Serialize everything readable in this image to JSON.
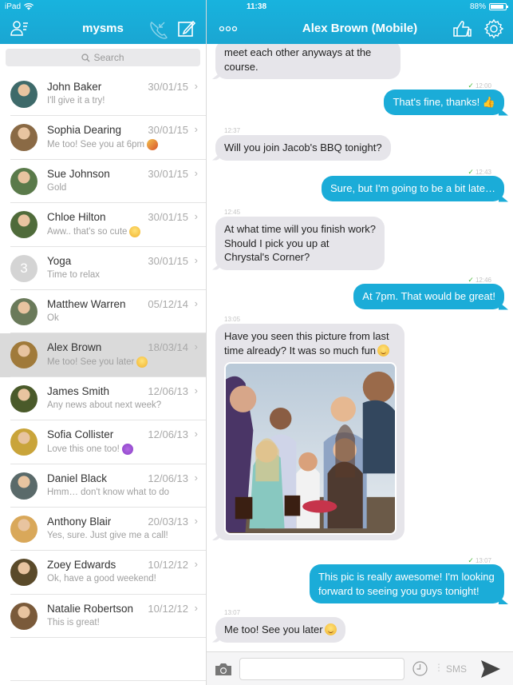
{
  "status_bar": {
    "device": "iPad",
    "time": "11:38",
    "battery": "88%",
    "battery_level": 0.88
  },
  "sidebar_header": {
    "title": "mysms",
    "icons": [
      "contacts-icon",
      "call-forward-icon",
      "compose-icon"
    ]
  },
  "chat_header": {
    "title": "Alex Brown (Mobile)",
    "icons": [
      "more-icon",
      "thumbs-up-icon",
      "gear-icon"
    ]
  },
  "search": {
    "placeholder": "Search"
  },
  "conversations": [
    {
      "name": "John Baker",
      "date": "30/01/15",
      "preview": "I'll give it a try!",
      "emoji": "",
      "avatar_color": "#3e6a6a"
    },
    {
      "name": "Sophia Dearing",
      "date": "30/01/15",
      "preview": "Me too! See you at 6pm",
      "emoji": "pizza",
      "avatar_color": "#8a6a45"
    },
    {
      "name": "Sue Johnson",
      "date": "30/01/15",
      "preview": "Gold",
      "emoji": "",
      "avatar_color": "#5a7a4a"
    },
    {
      "name": "Chloe Hilton",
      "date": "30/01/15",
      "preview": "Aww.. that's so cute",
      "emoji": "smile",
      "avatar_color": "#4f6b3a"
    },
    {
      "name": "Yoga",
      "date": "30/01/15",
      "preview": "Time to relax",
      "emoji": "",
      "placeholder": "3"
    },
    {
      "name": "Matthew Warren",
      "date": "05/12/14",
      "preview": "Ok",
      "emoji": "",
      "avatar_color": "#6a7a5a"
    },
    {
      "name": "Alex Brown",
      "date": "18/03/14",
      "preview": "Me too! See you later",
      "emoji": "smile",
      "avatar_color": "#a07a3a",
      "selected": true
    },
    {
      "name": "James Smith",
      "date": "12/06/13",
      "preview": "Any news about next week?",
      "emoji": "",
      "avatar_color": "#4a5a2a"
    },
    {
      "name": "Sofia Collister",
      "date": "12/06/13",
      "preview": "Love this one too!",
      "emoji": "purple-heart",
      "avatar_color": "#c9a43a"
    },
    {
      "name": "Daniel Black",
      "date": "12/06/13",
      "preview": "Hmm… don't know what to do",
      "emoji": "",
      "avatar_color": "#5a6a6a"
    },
    {
      "name": "Anthony Blair",
      "date": "20/03/13",
      "preview": "Yes, sure. Just give me a call!",
      "emoji": "",
      "avatar_color": "#d9a85a"
    },
    {
      "name": "Zoey Edwards",
      "date": "10/12/12",
      "preview": "Ok, have a good weekend!",
      "emoji": "",
      "avatar_color": "#5a4a2a"
    },
    {
      "name": "Natalie Robertson",
      "date": "10/12/12",
      "preview": "This is great!",
      "emoji": "",
      "avatar_color": "#7a5a3a"
    }
  ],
  "messages": [
    {
      "dir": "in",
      "text": "meet each other anyways at the course.",
      "time": ""
    },
    {
      "dir": "out",
      "text": "That's fine, thanks! 👍",
      "time": "12:00",
      "delivered": true
    },
    {
      "dir": "in",
      "text": "Will you join Jacob's BBQ tonight?",
      "time": "12:37"
    },
    {
      "dir": "out",
      "text": "Sure, but I'm going to be a bit late…",
      "time": "12:43",
      "delivered": true
    },
    {
      "dir": "in",
      "text": "At what time will you finish work? Should I pick you up at Chrystal's Corner?",
      "time": "12:45"
    },
    {
      "dir": "out",
      "text": "At 7pm. That would be great!",
      "time": "12:46",
      "delivered": true
    },
    {
      "dir": "in",
      "text": "Have you seen this picture from last time already? It was so much fun",
      "time": "13:05",
      "has_photo": true,
      "photo_alt": "Group of friends toasting drinks outdoors"
    },
    {
      "dir": "out",
      "text": "This pic is really awesome! I'm looking forward to seeing you guys tonight!",
      "time": "13:07",
      "delivered": true
    },
    {
      "dir": "in",
      "text": "Me too! See you later",
      "time": "13:07"
    }
  ],
  "composer": {
    "input_value": "",
    "placeholder": "",
    "channel_label": "SMS"
  },
  "colors": {
    "accent": "#1aacd8",
    "incoming_bubble": "#e6e5ea",
    "delivered_check": "#4cba3a",
    "selected_row": "#dadada"
  }
}
